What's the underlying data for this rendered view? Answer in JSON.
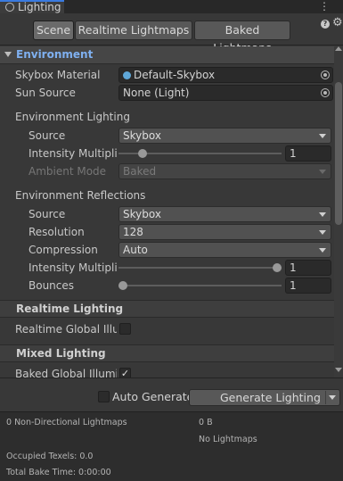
{
  "window": {
    "tab_title": "Lighting",
    "menu_glyph": "⋮"
  },
  "toolbar": {
    "tabs": [
      {
        "label": "Scene",
        "active": true
      },
      {
        "label": "Realtime Lightmaps",
        "active": false
      },
      {
        "label": "Baked Lightmaps",
        "active": false
      }
    ],
    "help_glyph": "?",
    "gear_glyph": "⚙"
  },
  "environment": {
    "header": "Environment",
    "skybox_material": {
      "label": "Skybox Material",
      "value": "Default-Skybox"
    },
    "sun_source": {
      "label": "Sun Source",
      "value": "None (Light)"
    },
    "lighting": {
      "header": "Environment Lighting",
      "source": {
        "label": "Source",
        "value": "Skybox"
      },
      "intensity": {
        "label": "Intensity Multiplie",
        "value": "1",
        "fraction": 0.125
      },
      "ambient_mode": {
        "label": "Ambient Mode",
        "value": "Baked"
      }
    },
    "reflections": {
      "header": "Environment Reflections",
      "source": {
        "label": "Source",
        "value": "Skybox"
      },
      "resolution": {
        "label": "Resolution",
        "value": "128"
      },
      "compression": {
        "label": "Compression",
        "value": "Auto"
      },
      "intensity": {
        "label": "Intensity Multiplie",
        "value": "1",
        "fraction": 1.0
      },
      "bounces": {
        "label": "Bounces",
        "value": "1",
        "fraction": 0.0
      }
    }
  },
  "realtime_lighting": {
    "header": "Realtime Lighting",
    "global_illum": {
      "label": "Realtime Global Illum",
      "checked": false
    }
  },
  "mixed_lighting": {
    "header": "Mixed Lighting",
    "baked_global_illum": {
      "label": "Baked Global Illumin",
      "checked": true,
      "check_glyph": "✓"
    }
  },
  "bottom": {
    "auto_generate": {
      "label": "Auto Generate",
      "checked": false
    },
    "generate_button": "Generate Lighting"
  },
  "stats": {
    "lightmaps": "0 Non-Directional Lightmaps",
    "size": "0 B",
    "no_lightmaps": "No Lightmaps",
    "occupied_texels": "Occupied Texels: 0.0",
    "bake_time": "Total Bake Time: 0:00:00"
  },
  "colors": {
    "accent": "#3a7ae0",
    "header_blue": "#7fb0f0",
    "background": "#383838"
  }
}
